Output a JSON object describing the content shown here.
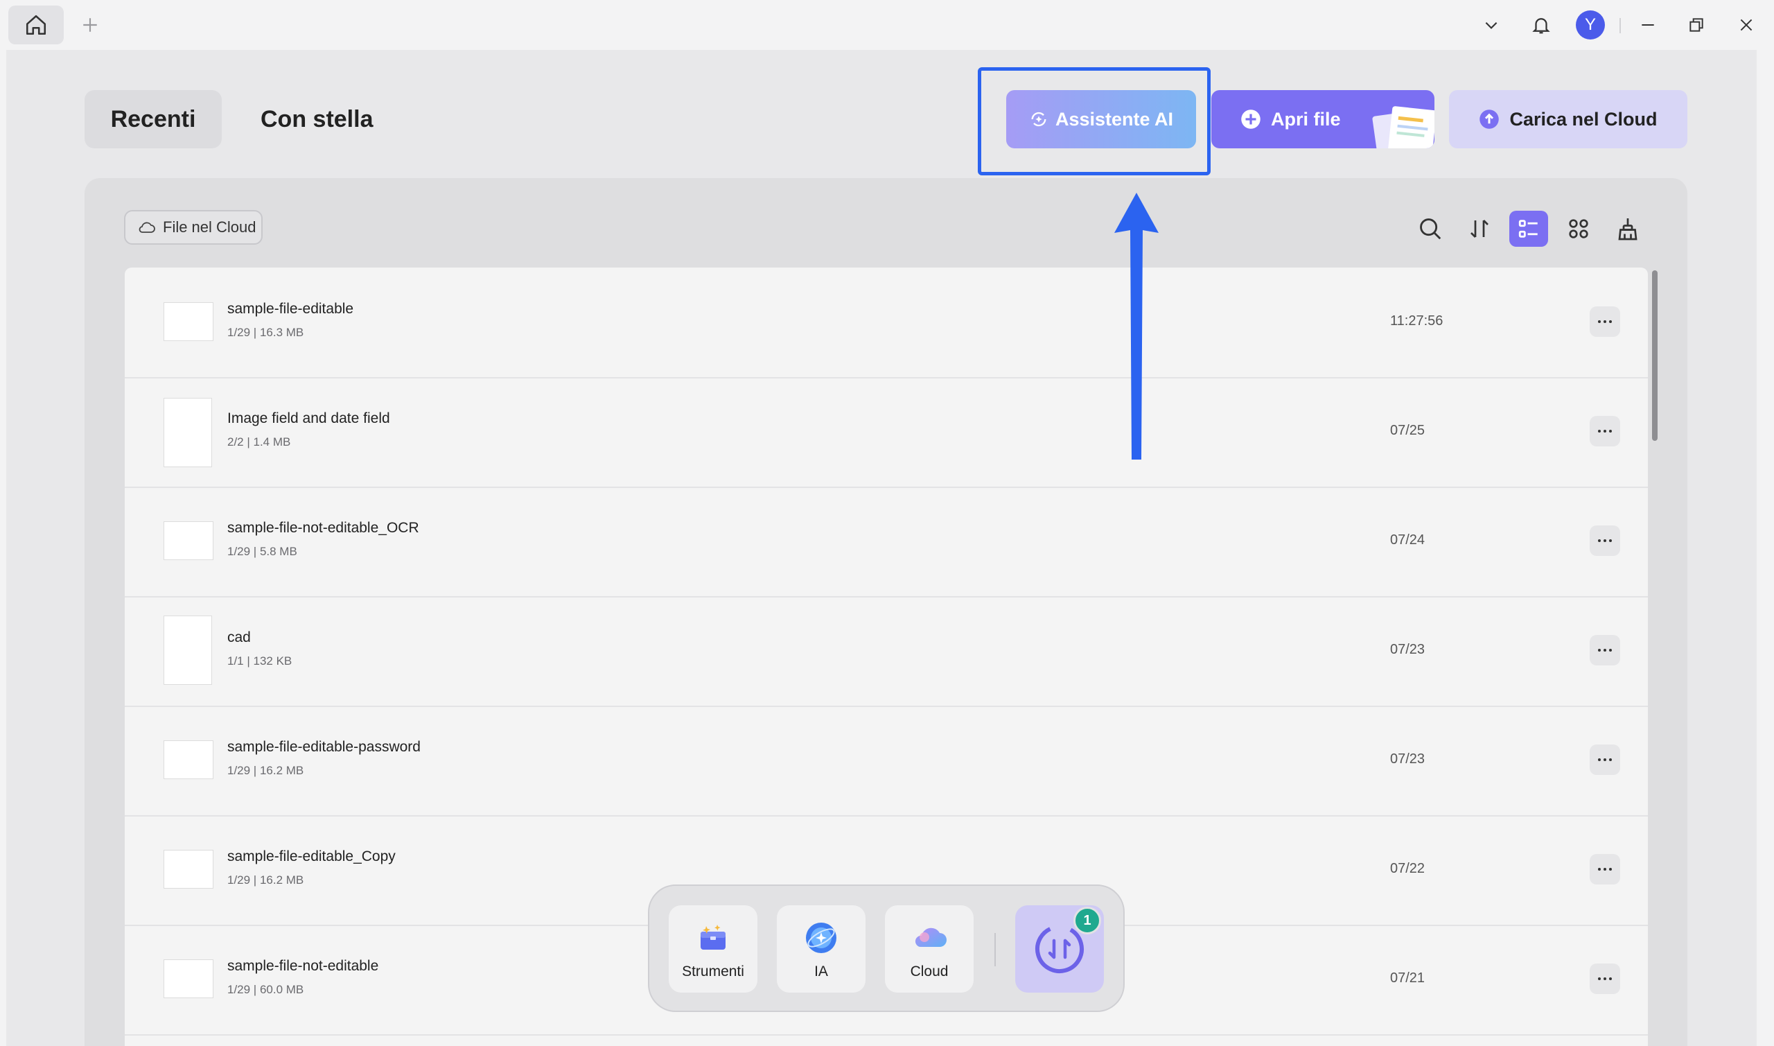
{
  "tabs": {
    "recent": "Recenti",
    "starred": "Con stella"
  },
  "actions": {
    "ai_assistant": "Assistente AI",
    "open_file": "Apri file",
    "upload_cloud": "Carica nel Cloud"
  },
  "user": {
    "avatar_initial": "Y"
  },
  "filter": {
    "cloud_files": "File nel Cloud"
  },
  "files": [
    {
      "name": "sample-file-editable",
      "meta": "1/29 | 16.3 MB",
      "date": "11:27:56"
    },
    {
      "name": "Image field and date field",
      "meta": "2/2 | 1.4 MB",
      "date": "07/25"
    },
    {
      "name": "sample-file-not-editable_OCR",
      "meta": "1/29 | 5.8 MB",
      "date": "07/24"
    },
    {
      "name": "cad",
      "meta": "1/1 | 132 KB",
      "date": "07/23"
    },
    {
      "name": "sample-file-editable-password",
      "meta": "1/29 | 16.2 MB",
      "date": "07/23"
    },
    {
      "name": "sample-file-editable_Copy",
      "meta": "1/29 | 16.2 MB",
      "date": "07/22"
    },
    {
      "name": "sample-file-not-editable",
      "meta": "1/29 | 60.0 MB",
      "date": "07/21"
    }
  ],
  "dock": {
    "tools": "Strumenti",
    "ai": "IA",
    "cloud": "Cloud",
    "badge_count": "1"
  },
  "colors": {
    "accent": "#7b6ff2",
    "highlight": "#2b63f0",
    "badge": "#1fa98f"
  }
}
